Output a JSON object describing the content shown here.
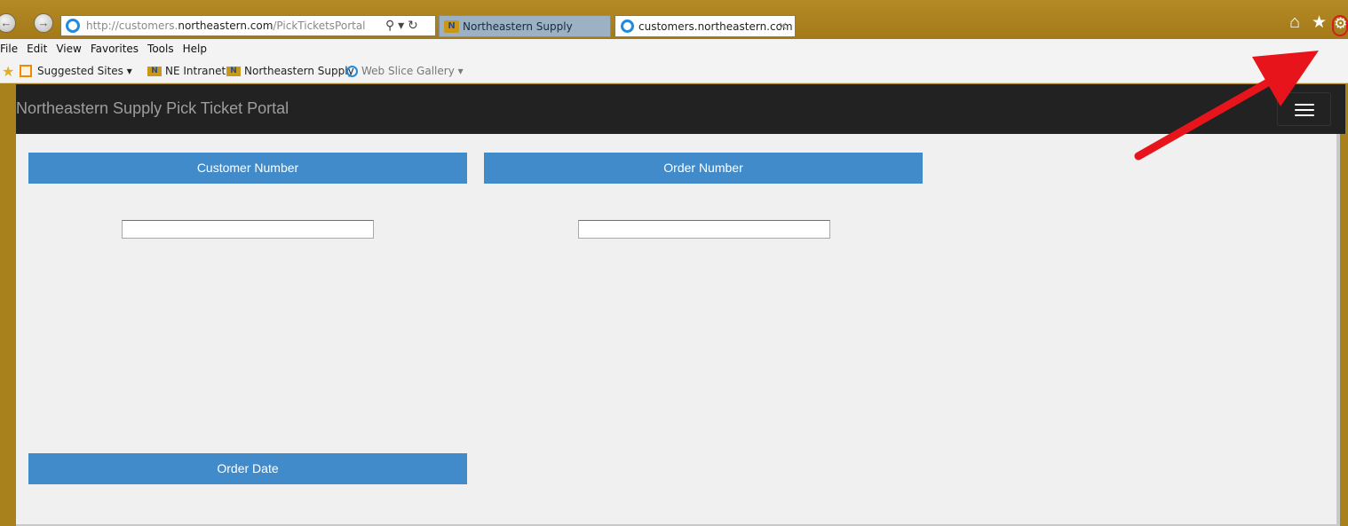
{
  "browser": {
    "url_prefix": "http://customers.",
    "url_domain": "northeastern.com",
    "url_path": "/PickTicketsPortal",
    "tabs": [
      {
        "label": "Northeastern Supply"
      },
      {
        "label": "customers.northeastern.com"
      }
    ],
    "menu": [
      "File",
      "Edit",
      "View",
      "Favorites",
      "Tools",
      "Help"
    ],
    "favorites": {
      "suggested": "Suggested Sites ▾",
      "intranet": "NE Intranet",
      "supply": "Northeastern Supply",
      "slice": "Web Slice Gallery ▾"
    },
    "highlight_color": "#d81b1b"
  },
  "portal": {
    "title": "Northeastern Supply Pick Ticket Portal",
    "accent": "#428bca",
    "fields": {
      "customer_number": {
        "label": "Customer Number",
        "value": ""
      },
      "order_number": {
        "label": "Order Number",
        "value": ""
      },
      "order_date": {
        "label": "Order Date"
      }
    }
  }
}
